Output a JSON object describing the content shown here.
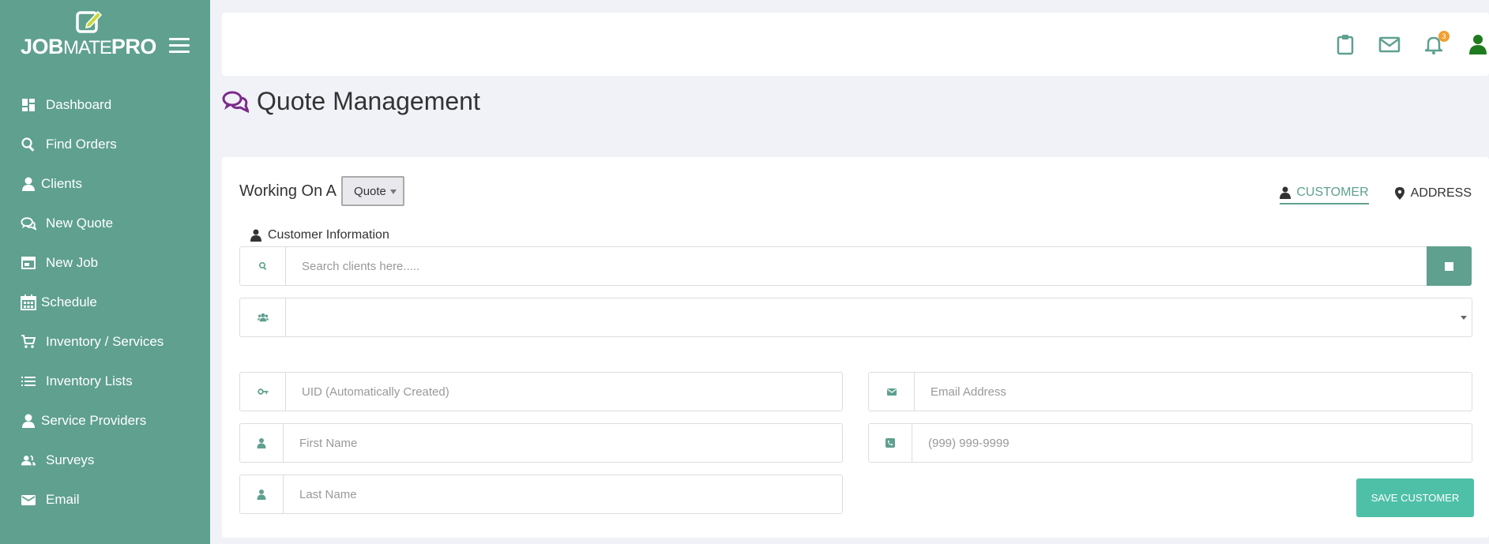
{
  "app": {
    "logo_job": "JOB",
    "logo_mate": "MATE",
    "logo_pro": "PRO"
  },
  "sidebar": {
    "items": [
      {
        "label": "Dashboard",
        "icon": "dashboard-icon"
      },
      {
        "label": "Find Orders",
        "icon": "search-icon"
      },
      {
        "label": "Clients",
        "icon": "user-icon"
      },
      {
        "label": "New Quote",
        "icon": "chat-icon"
      },
      {
        "label": "New Job",
        "icon": "window-icon"
      },
      {
        "label": "Schedule",
        "icon": "calendar-icon"
      },
      {
        "label": "Inventory / Services",
        "icon": "cart-icon"
      },
      {
        "label": "Inventory Lists",
        "icon": "list-icon"
      },
      {
        "label": "Service Providers",
        "icon": "user-icon"
      },
      {
        "label": "Surveys",
        "icon": "people-icon"
      },
      {
        "label": "Email",
        "icon": "mail-icon"
      }
    ]
  },
  "topbar": {
    "notification_count": "3"
  },
  "page": {
    "title": "Quote Management"
  },
  "form": {
    "working_on_label": "Working On A",
    "working_on_value": "Quote",
    "tabs": [
      {
        "label": "CUSTOMER",
        "active": true
      },
      {
        "label": "ADDRESS",
        "active": false
      }
    ],
    "section_label": "Customer Information",
    "search_placeholder": "Search clients here.....",
    "uid_placeholder": "UID (Automatically Created)",
    "first_name_placeholder": "First Name",
    "last_name_placeholder": "Last Name",
    "email_placeholder": "Email Address",
    "phone_placeholder": "(999) 999-9999",
    "save_label": "SAVE CUSTOMER"
  },
  "colors": {
    "sidebar": "#5fa08f",
    "accent": "#5fa08f",
    "save_button": "#4fc0a8",
    "title_icon": "#7b2a8c",
    "user_icon": "#1e7a1e"
  }
}
